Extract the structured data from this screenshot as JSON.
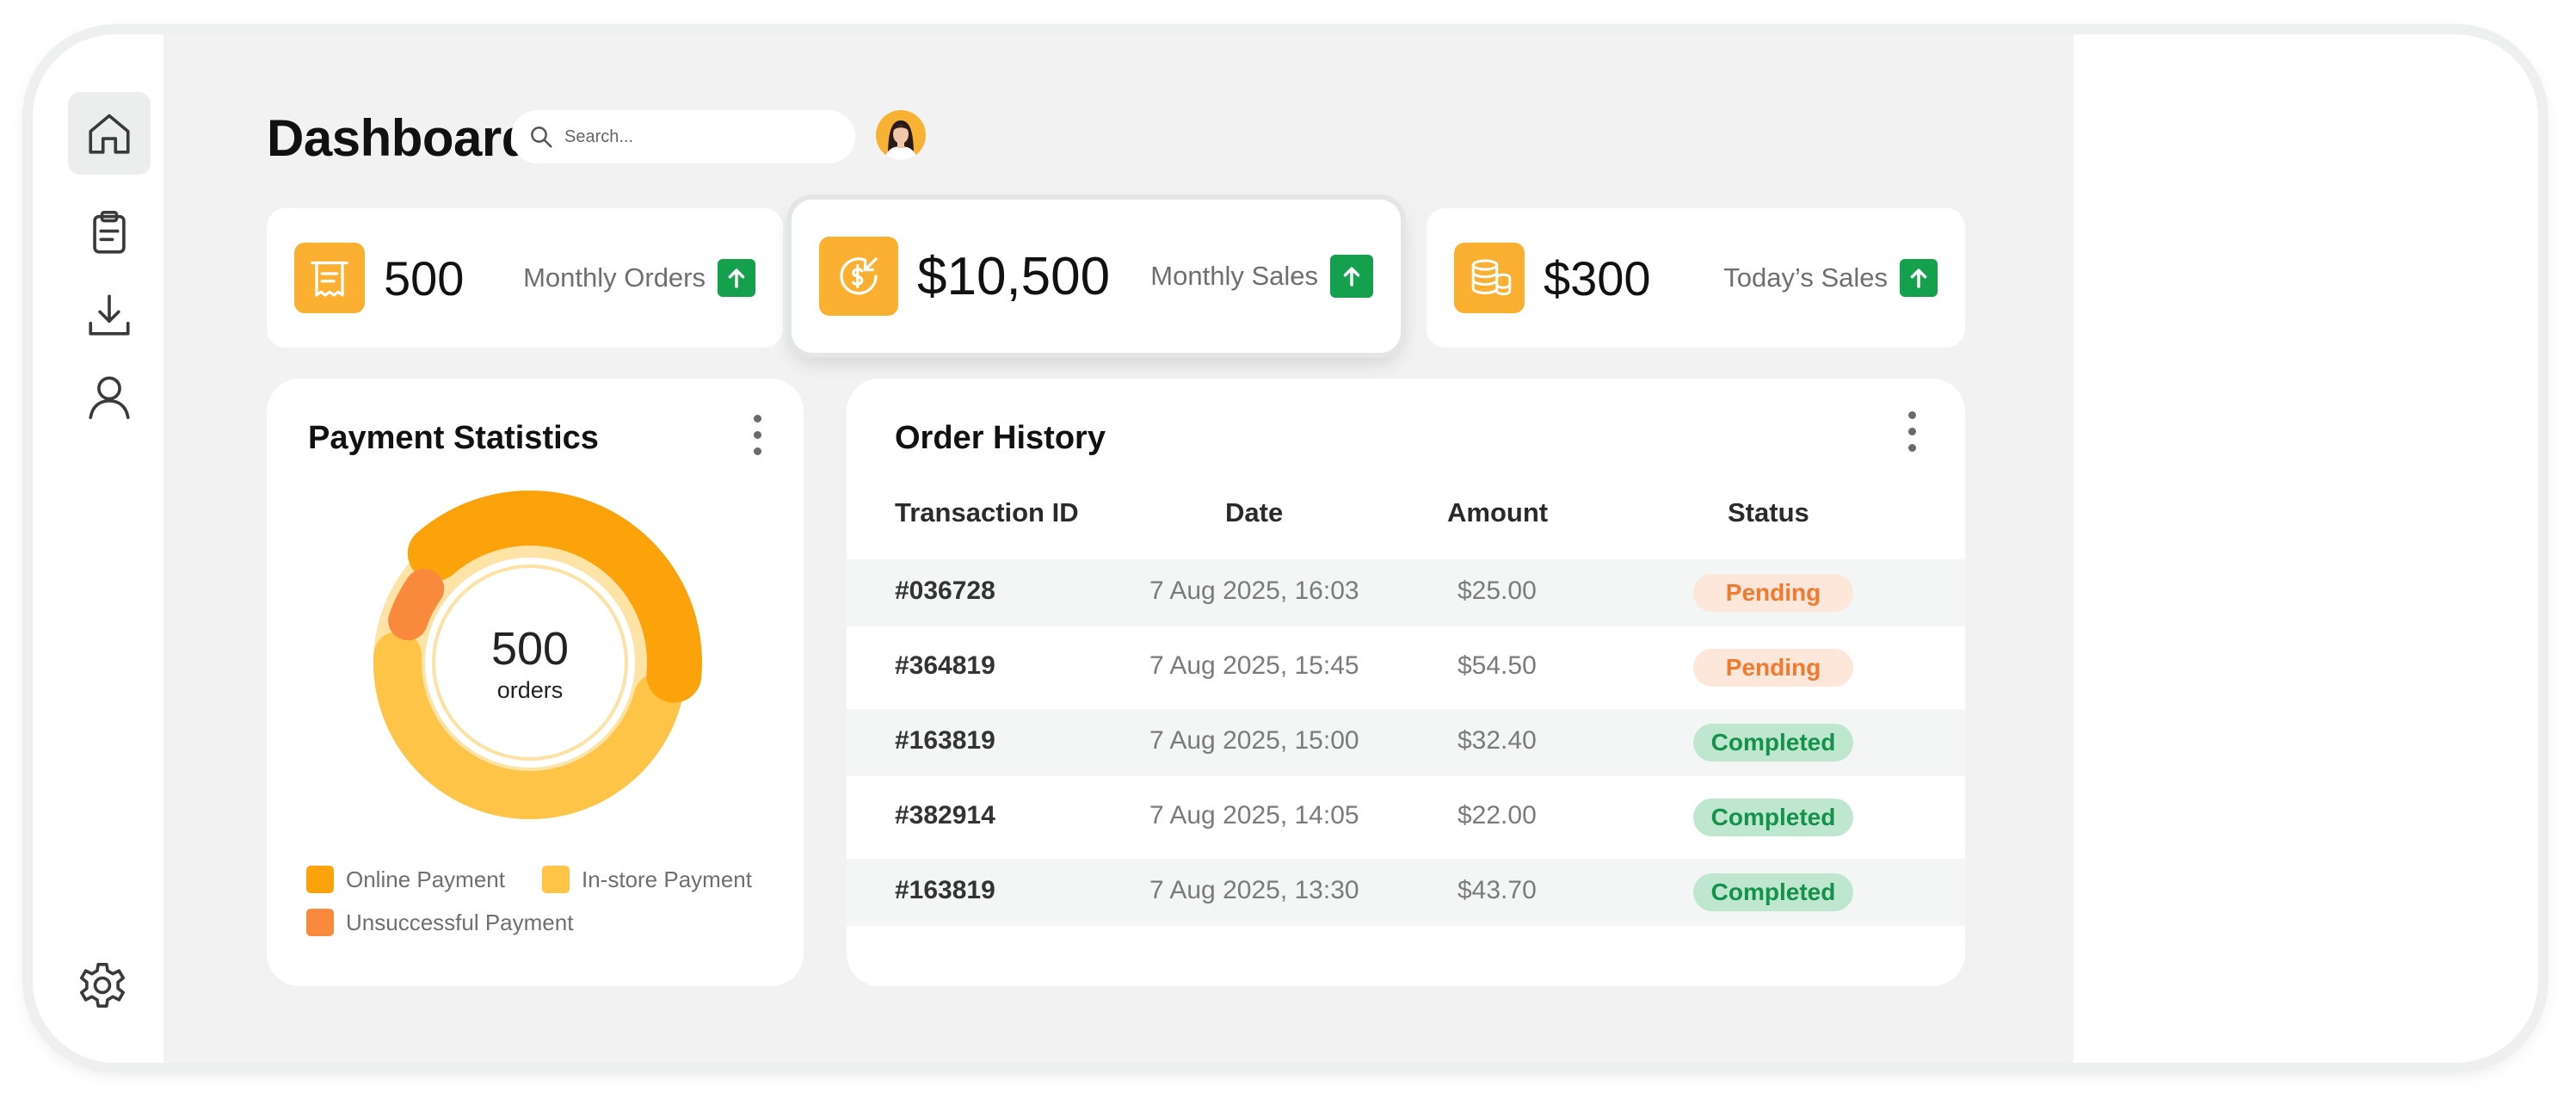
{
  "header": {
    "title": "Dashboard",
    "search_placeholder": "Search..."
  },
  "sidebar": {
    "items": [
      {
        "name": "home",
        "icon": "home-icon",
        "active": true
      },
      {
        "name": "orders",
        "icon": "clipboard-icon",
        "active": false
      },
      {
        "name": "downloads",
        "icon": "download-icon",
        "active": false
      },
      {
        "name": "profile",
        "icon": "user-icon",
        "active": false
      },
      {
        "name": "settings",
        "icon": "gear-icon",
        "active": false
      }
    ]
  },
  "stats": [
    {
      "value": "500",
      "label": "Monthly Orders",
      "icon": "receipt-icon",
      "trend": "up"
    },
    {
      "value": "$10,500",
      "label": "Monthly Sales",
      "icon": "dollar-cycle-icon",
      "trend": "up"
    },
    {
      "value": "$300",
      "label": "Today’s Sales",
      "icon": "coins-icon",
      "trend": "up"
    }
  ],
  "payment_statistics": {
    "title": "Payment Statistics",
    "total": "500",
    "unit": "orders",
    "legend": [
      {
        "label": "Online Payment",
        "color": "#fca30b"
      },
      {
        "label": "In-store Payment",
        "color": "#fec448"
      },
      {
        "label": "Unsuccessful Payment",
        "color": "#f98a3d"
      }
    ],
    "chart_data": {
      "type": "pie",
      "categories": [
        "Online Payment",
        "In-store Payment",
        "Unsuccessful Payment"
      ],
      "values": [
        0.4,
        0.5,
        0.1
      ]
    }
  },
  "order_history": {
    "title": "Order History",
    "columns": [
      "Transaction ID",
      "Date",
      "Amount",
      "Status"
    ],
    "rows": [
      {
        "id": "#036728",
        "date": "7 Aug 2025, 16:03",
        "amount": "$25.00",
        "status": "Pending"
      },
      {
        "id": "#364819",
        "date": "7 Aug 2025, 15:45",
        "amount": "$54.50",
        "status": "Pending"
      },
      {
        "id": "#163819",
        "date": "7 Aug 2025, 15:00",
        "amount": "$32.40",
        "status": "Completed"
      },
      {
        "id": "#382914",
        "date": "7 Aug 2025, 14:05",
        "amount": "$22.00",
        "status": "Completed"
      },
      {
        "id": "#163819",
        "date": "7 Aug 2025, 13:30",
        "amount": "$43.70",
        "status": "Completed"
      }
    ]
  },
  "colors": {
    "accent": "#fbb032",
    "trend_up": "#14a04c",
    "pending_text": "#f27a2e",
    "pending_bg": "#fde6da",
    "completed_text": "#14924a",
    "completed_bg": "#bfe7cf",
    "background": "#f1f2f1"
  }
}
